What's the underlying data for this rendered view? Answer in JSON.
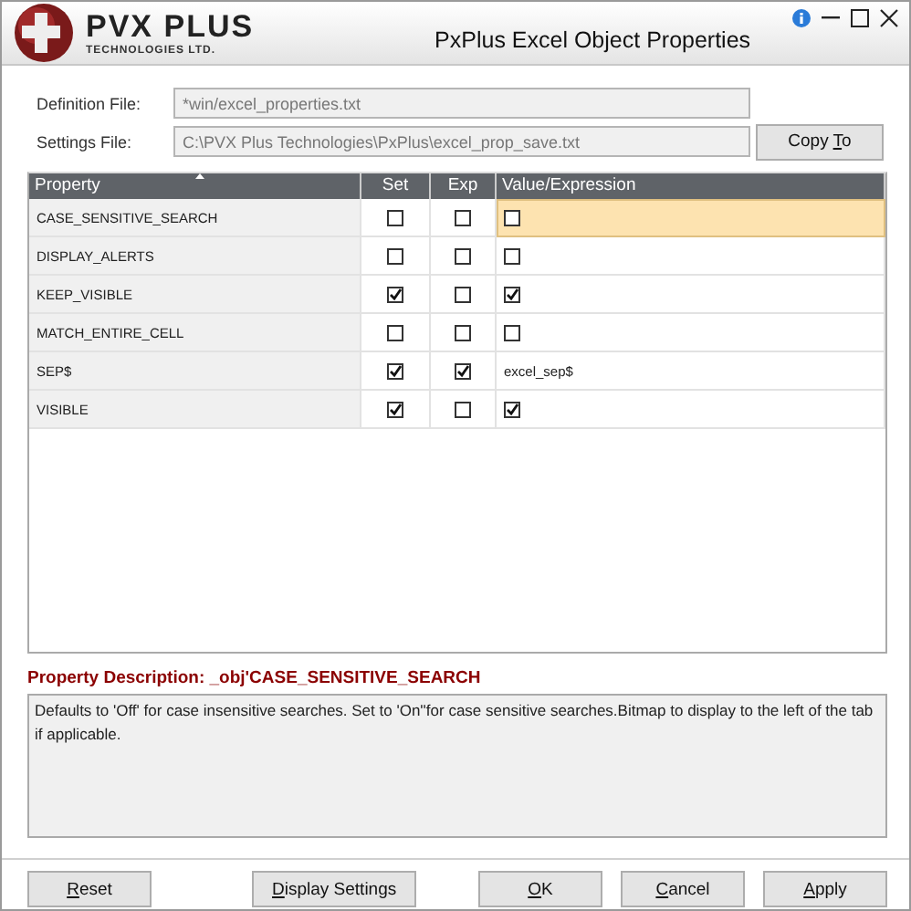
{
  "window": {
    "logo_name": "PVX PLUS",
    "logo_tagline": "TECHNOLOGIES LTD.",
    "title": "PxPlus Excel Object Properties"
  },
  "fields": [
    {
      "label": "Definition File:",
      "value": "*win/excel_properties.txt"
    },
    {
      "label": "Settings File:",
      "value": "C:\\PVX Plus Technologies\\PxPlus\\excel_prop_save.txt"
    }
  ],
  "copy_button": {
    "before": "Copy ",
    "mnemonic": "T",
    "after": "o"
  },
  "table": {
    "columns": [
      {
        "label": "Property",
        "sorted": true
      },
      {
        "label": "Set",
        "sorted": false
      },
      {
        "label": "Exp",
        "sorted": false
      },
      {
        "label": "Value/Expression",
        "sorted": false
      }
    ],
    "rows": [
      {
        "property": "CASE_SENSITIVE_SEARCH",
        "set": false,
        "exp": false,
        "value": {
          "kind": "checkbox",
          "checked": false
        },
        "selected": true
      },
      {
        "property": "DISPLAY_ALERTS",
        "set": false,
        "exp": false,
        "value": {
          "kind": "checkbox",
          "checked": false
        },
        "selected": false
      },
      {
        "property": "KEEP_VISIBLE",
        "set": true,
        "exp": false,
        "value": {
          "kind": "checkbox",
          "checked": true
        },
        "selected": false
      },
      {
        "property": "MATCH_ENTIRE_CELL",
        "set": false,
        "exp": false,
        "value": {
          "kind": "checkbox",
          "checked": false
        },
        "selected": false
      },
      {
        "property": "SEP$",
        "set": true,
        "exp": true,
        "value": {
          "kind": "text",
          "text": "excel_sep$"
        },
        "selected": false
      },
      {
        "property": "VISIBLE",
        "set": true,
        "exp": false,
        "value": {
          "kind": "checkbox",
          "checked": true
        },
        "selected": false
      }
    ]
  },
  "description": {
    "title": "Property Description:  _obj'CASE_SENSITIVE_SEARCH",
    "text": "Defaults to 'Off' for case insensitive searches. Set to 'On''for case sensitive searches.Bitmap to display to the left of the tab if applicable."
  },
  "buttons_left": [
    {
      "mnemonic": "R",
      "after": "eset"
    },
    {
      "mnemonic": "D",
      "after": "isplay Settings"
    }
  ],
  "buttons_right": [
    {
      "mnemonic": "O",
      "after": "K"
    },
    {
      "mnemonic": "C",
      "after": "ancel"
    },
    {
      "mnemonic": "A",
      "after": "pply"
    }
  ]
}
